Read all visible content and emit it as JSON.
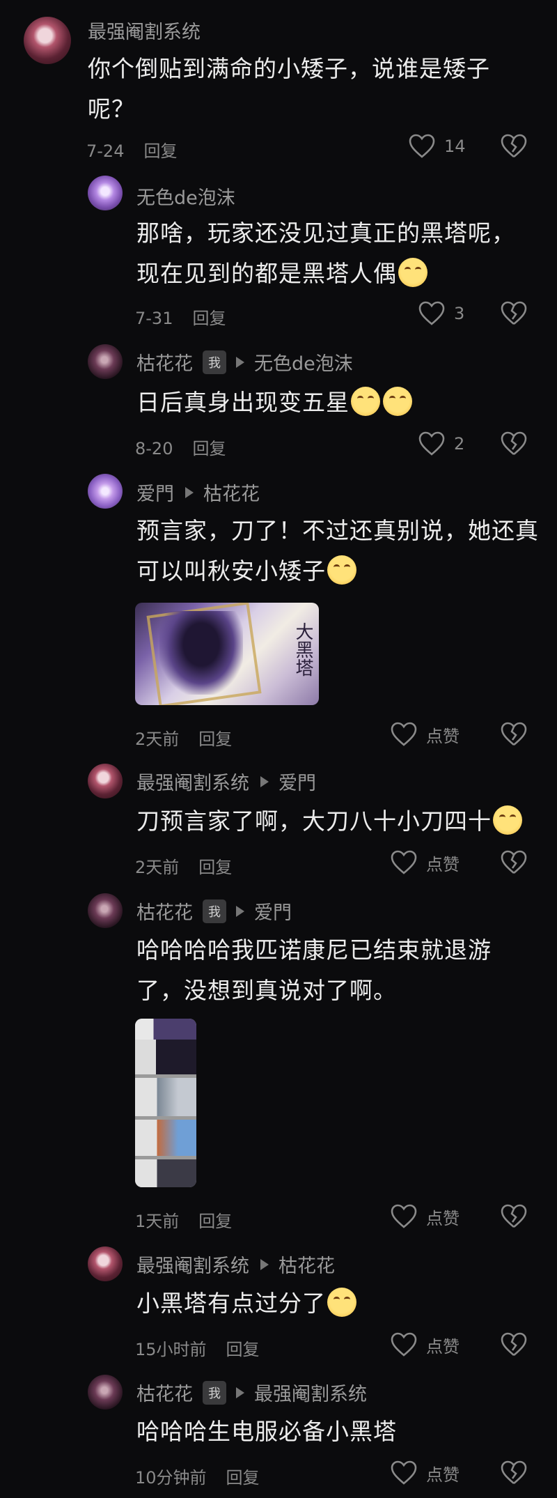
{
  "comments": [
    {
      "id": "c1",
      "author": "最强阉割系统",
      "is_me": false,
      "reply_to": "",
      "avatar_icon": "avatar-red-hair-girl",
      "lines": [
        "你个倒贴到满命的小矮子，说谁是矮子",
        "呢？"
      ],
      "time": "7-24",
      "reply_label": "回复",
      "likes": "14"
    },
    {
      "id": "c2",
      "author": "无色de泡沫",
      "is_me": false,
      "reply_to": "",
      "avatar_icon": "avatar-purple-character",
      "lines": [
        "那啥，玩家还没见过真正的黑塔呢，",
        "现在见到的都是黑塔人偶"
      ],
      "emoji": "😂",
      "time": "7-31",
      "reply_label": "回复",
      "likes": "3"
    },
    {
      "id": "c3",
      "author": "枯花花",
      "is_me": true,
      "me_badge": "我",
      "reply_to": "无色de泡沫",
      "avatar_icon": "avatar-dark-anime-girl",
      "lines": [
        "日后真身出现变五星"
      ],
      "emoji": "😊😊",
      "time": "8-20",
      "reply_label": "回复",
      "likes": "2"
    },
    {
      "id": "c4",
      "author": "爱門",
      "is_me": false,
      "reply_to": "枯花花",
      "avatar_icon": "avatar-purple-flower",
      "lines": [
        "预言家，刀了！不过还真别说，她还真",
        "可以叫秋安小矮子"
      ],
      "emoji": "😅",
      "image_text": "大黑塔",
      "time": "2天前",
      "reply_label": "回复",
      "likes": "点赞"
    },
    {
      "id": "c5",
      "author": "最强阉割系统",
      "is_me": false,
      "reply_to": "爱門",
      "avatar_icon": "avatar-red-hair-girl",
      "lines": [
        "刀预言家了啊，大刀八十小刀四十"
      ],
      "emoji": "😊",
      "time": "2天前",
      "reply_label": "回复",
      "likes": "点赞"
    },
    {
      "id": "c6",
      "author": "枯花花",
      "is_me": true,
      "me_badge": "我",
      "reply_to": "爱門",
      "avatar_icon": "avatar-dark-anime-girl",
      "lines": [
        "哈哈哈哈我匹诺康尼已结束就退游",
        "了，没想到真说对了啊。"
      ],
      "time": "1天前",
      "reply_label": "回复",
      "likes": "点赞"
    },
    {
      "id": "c7",
      "author": "最强阉割系统",
      "is_me": false,
      "reply_to": "枯花花",
      "avatar_icon": "avatar-red-hair-girl",
      "lines": [
        "小黑塔有点过分了"
      ],
      "emoji": "😭",
      "time": "15小时前",
      "reply_label": "回复",
      "likes": "点赞"
    },
    {
      "id": "c8",
      "author": "枯花花",
      "is_me": true,
      "me_badge": "我",
      "reply_to": "最强阉割系统",
      "avatar_icon": "avatar-dark-anime-girl",
      "lines": [
        "哈哈哈生电服必备小黑塔"
      ],
      "time": "10分钟前",
      "reply_label": "回复",
      "likes": "点赞"
    }
  ],
  "icons": {
    "like": "heart-outline-icon",
    "dislike": "broken-heart-icon",
    "reply_arrow": "triangle-right-icon"
  },
  "colors": {
    "background": "#0b0b0d",
    "text": "#ececec",
    "muted": "#8a8a8a",
    "badge_bg": "#3a3a3c"
  }
}
